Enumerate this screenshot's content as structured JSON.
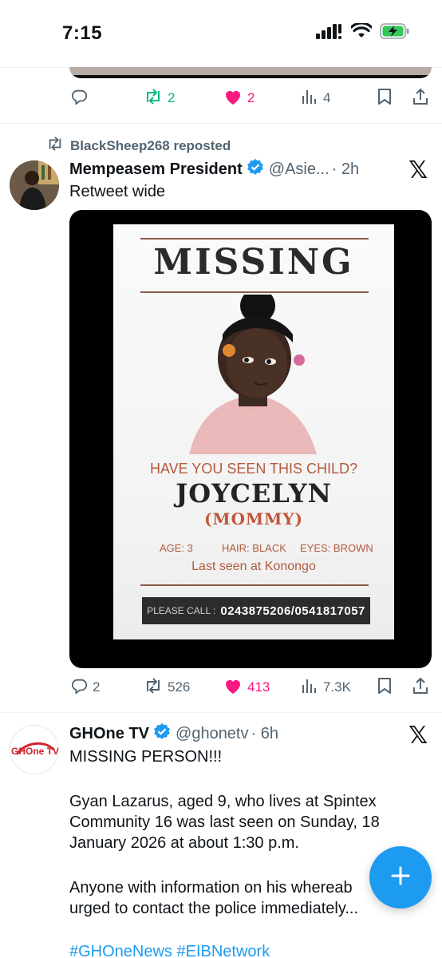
{
  "status_bar": {
    "time": "7:15"
  },
  "previous_tweet": {
    "retweets": "2",
    "likes": "2",
    "views": "4"
  },
  "repost_banner": {
    "text": "BlackSheep268 reposted"
  },
  "tweet1": {
    "author_name": "Mempeasem President",
    "handle": "@Asie...",
    "time": "· 2h",
    "text": "Retweet wide",
    "poster": {
      "title": "MISSING",
      "question": "HAVE YOU SEEN THIS CHILD?",
      "name": "JOYCELYN",
      "nickname": "(MOMMY)",
      "age": "AGE: 3",
      "hair": "HAIR: BLACK",
      "eyes": "EYES: BROWN",
      "last_seen": "Last seen at Konongo",
      "call_label": "PLEASE CALL :",
      "call_numbers": "0243875206/0541817057"
    },
    "replies": "2",
    "retweets": "526",
    "likes": "413",
    "views": "7.3K"
  },
  "tweet2": {
    "author_name": "GHOne TV",
    "handle": "@ghonetv",
    "time": "· 6h",
    "avatar_text": "GHOne TV",
    "line1": "MISSING PERSON!!!",
    "para1_l1": "Gyan Lazarus, aged 9, who lives at Spintex",
    "para1_l2": "Community 16 was last seen on Sunday, 18",
    "para1_l3": "January 2026 at about 1:30 p.m.",
    "para2_l1": "Anyone with information on his whereab",
    "para2_l2": "urged to contact the police immediately...",
    "hashtags": "#GHOneNews #EIBNetwork"
  },
  "colors": {
    "accent": "#1d9bf0",
    "like": "#f91880",
    "retweet": "#00ba7c",
    "muted": "#536471"
  }
}
